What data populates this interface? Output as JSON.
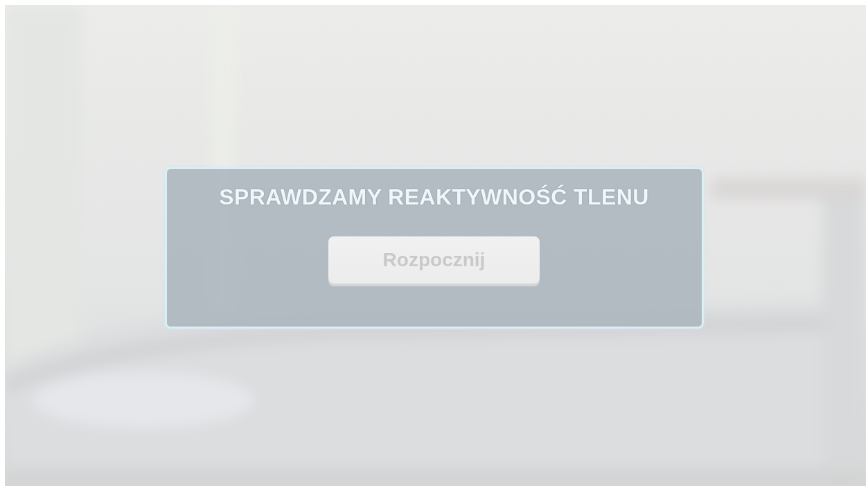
{
  "dialog": {
    "title": "SPRAWDZAMY REAKTYWNOŚĆ TLENU",
    "button": "Rozpocznij"
  }
}
